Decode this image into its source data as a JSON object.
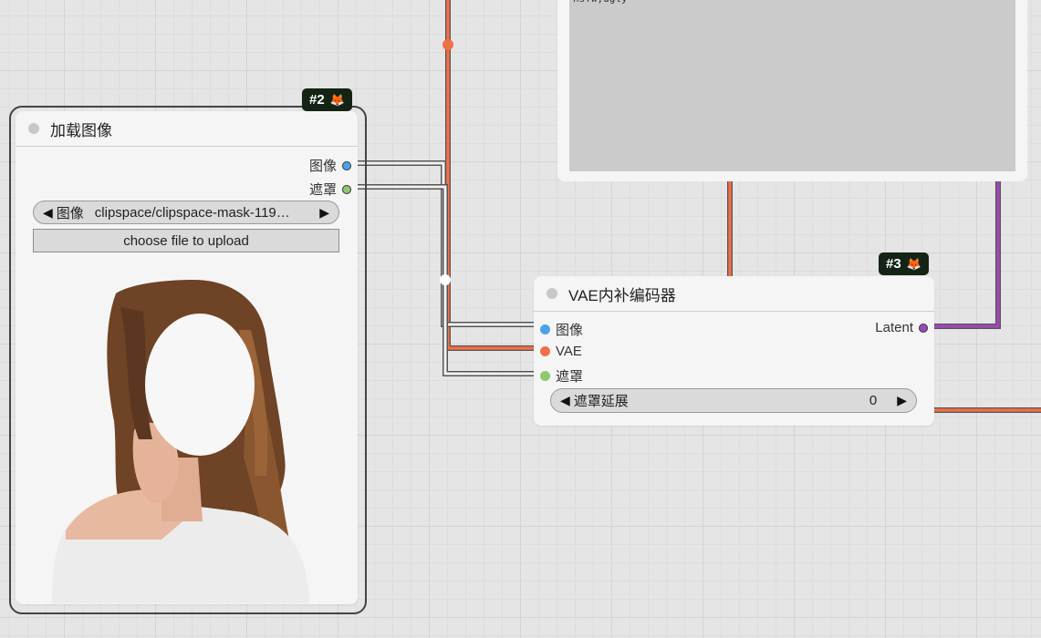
{
  "load_image_node": {
    "badge": "#2",
    "title": "加载图像",
    "outputs": {
      "image": "图像",
      "mask": "遮罩"
    },
    "image_widget": {
      "label": "图像",
      "value": "clipspace/clipspace-mask-119…"
    },
    "upload_label": "choose file to upload"
  },
  "vae_node": {
    "badge": "#3",
    "title": "VAE内补编码器",
    "inputs": {
      "image": "图像",
      "vae": "VAE",
      "mask": "遮罩"
    },
    "output": "Latent",
    "grow_mask": {
      "label": "遮罩延展",
      "value": "0"
    }
  },
  "prompt_node": {
    "text": "nsfw,ugly"
  },
  "colors": {
    "image": "#4da3ea",
    "mask": "#8fc86e",
    "vae": "#f07048",
    "latent": "#a048b8",
    "badge_bg": "#132414"
  }
}
